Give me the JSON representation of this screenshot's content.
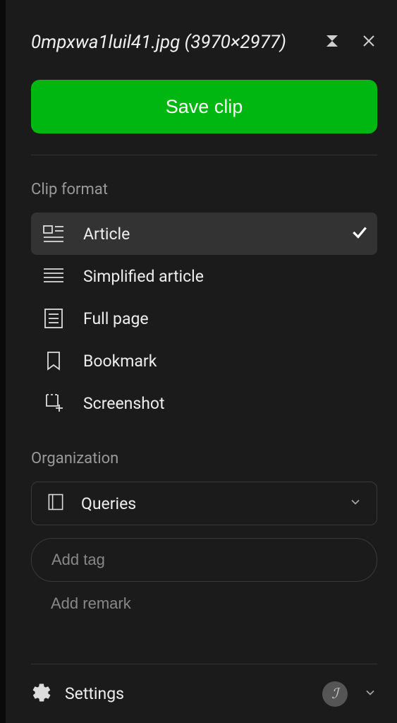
{
  "header": {
    "title": "0mpxwa1luil41.jpg (3970×2977)"
  },
  "actions": {
    "save_label": "Save clip"
  },
  "clip_format": {
    "section_label": "Clip format",
    "items": [
      {
        "label": "Article",
        "selected": true
      },
      {
        "label": "Simplified article",
        "selected": false
      },
      {
        "label": "Full page",
        "selected": false
      },
      {
        "label": "Bookmark",
        "selected": false
      },
      {
        "label": "Screenshot",
        "selected": false
      }
    ]
  },
  "organization": {
    "section_label": "Organization",
    "notebook_selected": "Queries",
    "tag_placeholder": "Add tag",
    "remark_placeholder": "Add remark"
  },
  "footer": {
    "settings_label": "Settings"
  }
}
